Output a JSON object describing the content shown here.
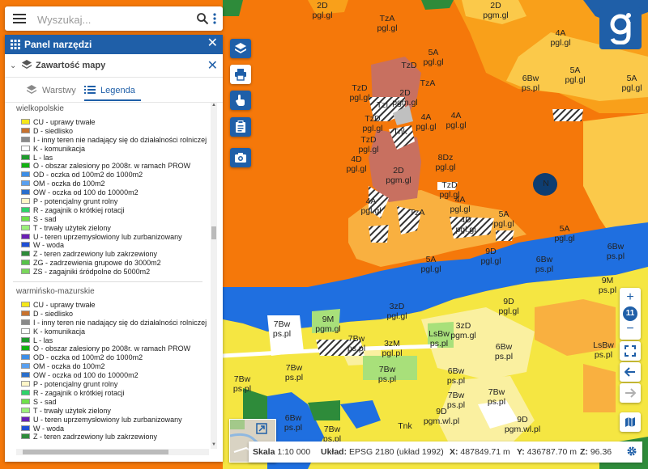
{
  "search": {
    "placeholder": "Wyszukaj..."
  },
  "panel": {
    "title": "Panel narzędzi",
    "subheader": "Zawartość mapy",
    "tabs": [
      {
        "label": "Warstwy"
      },
      {
        "label": "Legenda"
      }
    ],
    "active_tab": "Legenda"
  },
  "legend": {
    "sections": [
      {
        "name": "wielkopolskie",
        "items": [
          {
            "label": "CU - uprawy trwałe",
            "color": "#f5e71a"
          },
          {
            "label": "D - siedlisko",
            "color": "#c8722e"
          },
          {
            "label": "I - inny teren nie nadający się do działalności rolniczej",
            "color": "#8a8a8a"
          },
          {
            "label": "K - komunikacja",
            "color": "#ffffff"
          },
          {
            "label": "L - las",
            "color": "#1e9a2c"
          },
          {
            "label": "O - obszar zalesiony po 2008r. w ramach PROW",
            "color": "#13b213"
          },
          {
            "label": "OD - oczka od 100m2 do 1000m2",
            "color": "#3d8ee6"
          },
          {
            "label": "OM - oczka do 100m2",
            "color": "#5aa0f0"
          },
          {
            "label": "OW - oczka od 100 do 10000m2",
            "color": "#2a6fcc"
          },
          {
            "label": "P - potencjalny grunt rolny",
            "color": "#fff6c8"
          },
          {
            "label": "R - zagajnik o krótkiej rotacji",
            "color": "#2fd36a"
          },
          {
            "label": "S - sad",
            "color": "#6fe04a"
          },
          {
            "label": "T - trwały użytek zielony",
            "color": "#9cf07a"
          },
          {
            "label": "U - teren uprzemysłowiony lub zurbanizowany",
            "color": "#6a1fb5"
          },
          {
            "label": "W - woda",
            "color": "#1f4fd6"
          },
          {
            "label": "Z - teren zadrzewiony lub zakrzewiony",
            "color": "#2e8b3a"
          },
          {
            "label": "ZG - zadrzewienia grupowe do 3000m2",
            "color": "#58c24a"
          },
          {
            "label": "ZS - zagajniki śródpolne do 5000m2",
            "color": "#7ad65c"
          }
        ]
      },
      {
        "name": "warmińsko-mazurskie",
        "items": [
          {
            "label": "CU - uprawy trwałe",
            "color": "#f5e71a"
          },
          {
            "label": "D - siedlisko",
            "color": "#c8722e"
          },
          {
            "label": "I - inny teren nie nadający się do działalności rolniczej",
            "color": "#8a8a8a"
          },
          {
            "label": "K - komunikacja",
            "color": "#ffffff"
          },
          {
            "label": "L - las",
            "color": "#1e9a2c"
          },
          {
            "label": "O - obszar zalesiony po 2008r. w ramach PROW",
            "color": "#13b213"
          },
          {
            "label": "OD - oczka od 100m2 do 1000m2",
            "color": "#3d8ee6"
          },
          {
            "label": "OM - oczka do 100m2",
            "color": "#5aa0f0"
          },
          {
            "label": "OW - oczka od 100 do 10000m2",
            "color": "#2a6fcc"
          },
          {
            "label": "P - potencjalny grunt rolny",
            "color": "#fff6c8"
          },
          {
            "label": "R - zagajnik o krótkiej rotacji",
            "color": "#2fd36a"
          },
          {
            "label": "S - sad",
            "color": "#6fe04a"
          },
          {
            "label": "T - trwały użytek zielony",
            "color": "#9cf07a"
          },
          {
            "label": "U - teren uprzemysłowiony lub zurbanizowany",
            "color": "#6a1fb5"
          },
          {
            "label": "W - woda",
            "color": "#1f4fd6"
          },
          {
            "label": "Z - teren zadrzewiony lub zakrzewiony",
            "color": "#2e8b3a"
          }
        ]
      }
    ]
  },
  "map_labels": [
    {
      "code": "2D",
      "unit": "pgl.gl"
    },
    {
      "code": "2D",
      "unit": "pgm.gl"
    },
    {
      "code": "TzA",
      "unit": "pgl.gl"
    },
    {
      "code": "5A",
      "unit": "pgl.gl"
    },
    {
      "code": "4A",
      "unit": "pgl.gl"
    },
    {
      "code": "5A",
      "unit": "pgl.gl"
    },
    {
      "code": "5A",
      "unit": "pgl.gl"
    },
    {
      "code": "6Bw",
      "unit": "ps.pl"
    },
    {
      "code": "TzD",
      "unit": "pgl.gl"
    },
    {
      "code": "TzD",
      "unit": "pgl.gl"
    },
    {
      "code": "2D",
      "unit": "pgm.gl"
    },
    {
      "code": "Tzl",
      "unit": ""
    },
    {
      "code": "4A",
      "unit": "pgl.gl"
    },
    {
      "code": "TzD",
      "unit": ""
    },
    {
      "code": "Tnk",
      "unit": ""
    },
    {
      "code": "TzA",
      "unit": ""
    },
    {
      "code": "4A",
      "unit": "pgl.gl"
    },
    {
      "code": "TzD",
      "unit": "pgl.gl"
    },
    {
      "code": "4D",
      "unit": "pgl.gl"
    },
    {
      "code": "2D",
      "unit": "pgm.gl"
    },
    {
      "code": "8Dz",
      "unit": "pgl.gl"
    },
    {
      "code": "N",
      "unit": ""
    },
    {
      "code": "TzD",
      "unit": "pgl.gl"
    },
    {
      "code": "4A",
      "unit": "pgl.gl"
    },
    {
      "code": "4A",
      "unit": "pgl.gl"
    },
    {
      "code": "5A",
      "unit": "pgl.gl"
    },
    {
      "code": "TzA",
      "unit": ""
    },
    {
      "code": "4D",
      "unit": "pgl.gl"
    },
    {
      "code": "5A",
      "unit": "pgl.gl"
    },
    {
      "code": "5A",
      "unit": "pgl.gl"
    },
    {
      "code": "9D",
      "unit": "pgl.gl"
    },
    {
      "code": "6Bw",
      "unit": "ps.pl"
    },
    {
      "code": "6Bw",
      "unit": "ps.pl"
    },
    {
      "code": "9M",
      "unit": "ps.pl"
    },
    {
      "code": "9D",
      "unit": "pgl.gl"
    },
    {
      "code": "3zD",
      "unit": "pgl.gl"
    },
    {
      "code": "9M",
      "unit": "pgm.gl"
    },
    {
      "code": "3zD",
      "unit": "pgm.gl"
    },
    {
      "code": "LsBw",
      "unit": "ps.pl"
    },
    {
      "code": "7Bw",
      "unit": "ps.pl"
    },
    {
      "code": "7Bw",
      "unit": "ps.pl"
    },
    {
      "code": "6Bw",
      "unit": "ps.pl"
    },
    {
      "code": "LsBw",
      "unit": "ps.pl"
    },
    {
      "code": "3zM",
      "unit": "pgl.pl"
    },
    {
      "code": "7Bw",
      "unit": "ps.pl"
    },
    {
      "code": "7Bw",
      "unit": "ps.pl"
    },
    {
      "code": "6Bw",
      "unit": "ps.pl"
    },
    {
      "code": "7Bw",
      "unit": "ps.pl"
    },
    {
      "code": "7Bw",
      "unit": "ps.pl"
    },
    {
      "code": "7Bw",
      "unit": "ps.pl"
    },
    {
      "code": "9D",
      "unit": "pgm.wl.pl"
    },
    {
      "code": "9D",
      "unit": "pgm.wl.pl"
    },
    {
      "code": "6Bw",
      "unit": "ps.pl"
    },
    {
      "code": "7Bw",
      "unit": "ps.pl"
    },
    {
      "code": "Tnk",
      "unit": ""
    }
  ],
  "status": {
    "scale_label": "Skala",
    "scale_value": "1:10 000",
    "crs_label": "Układ:",
    "crs_value": "EPSG 2180 (układ 1992)",
    "x_label": "X:",
    "x_value": "487849.71 m",
    "y_label": "Y:",
    "y_value": "436787.70 m",
    "z_label": "Z:",
    "z_value": "96.36"
  },
  "zoom": {
    "level": "11",
    "plus": "+",
    "minus": "−"
  },
  "icons": {
    "menu": "menu-icon",
    "search": "search-icon",
    "more": "more-vert-icon",
    "layers": "layers-icon",
    "print": "print-icon",
    "touch": "touch-icon",
    "clipboard": "clipboard-icon",
    "camera": "camera-icon",
    "fullscreen": "fullscreen-icon",
    "back": "arrow-left-icon",
    "forward": "arrow-right-icon",
    "basemap": "basemap-icon",
    "settings": "gear-icon",
    "expand": "expand-icon",
    "logo": "geoportal-logo"
  }
}
